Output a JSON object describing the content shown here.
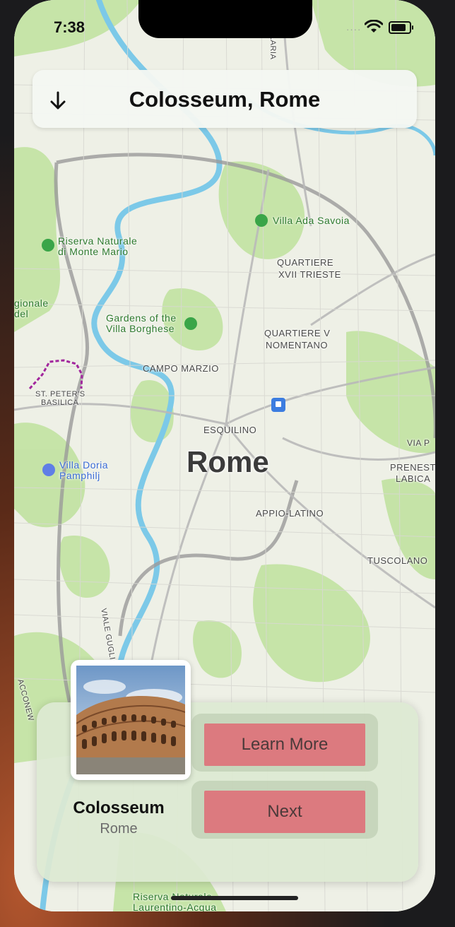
{
  "status_bar": {
    "time": "7:38"
  },
  "header": {
    "title": "Colosseum, Rome",
    "back_icon": "arrow-down-icon"
  },
  "map": {
    "city_label": "Rome",
    "labels": {
      "villa_ada": "Villa Ada Savoia",
      "riserva_1": "Riserva Naturale",
      "riserva_2": "di Monte Mario",
      "quartiere_trieste_1": "QUARTIERE",
      "quartiere_trieste_2": "XVII TRIESTE",
      "regionale_1": "gionale",
      "regionale_2": "del",
      "gardens_1": "Gardens of the",
      "gardens_2": "Villa Borghese",
      "nomentano_1": "QUARTIERE V",
      "nomentano_2": "NOMENTANO",
      "campo_marzio": "CAMPO MARZIO",
      "st_peters_1": "ST. PETER'S",
      "st_peters_2": "BASILICA",
      "esquilino": "ESQUILINO",
      "villa_doria_1": "Villa Doria",
      "villa_doria_2": "Pamphilj",
      "via_p": "VIA P",
      "prenest_1": "PRENEST",
      "prenest_2": "LABICA",
      "appio": "APPIO-LATINO",
      "tuscolano": "TUSCOLANO",
      "viale_gug": "VIALE GUGLIELMO",
      "salaria": "LARIA",
      "riserva_bottom_1": "Riserva Naturale",
      "riserva_bottom_2": "Laurentino-Acqua",
      "circonv": "ACCONEW"
    }
  },
  "place_card": {
    "name": "Colosseum",
    "subtitle": "Rome",
    "learn_more_label": "Learn More",
    "next_label": "Next"
  },
  "colors": {
    "button": "#dc7a7f",
    "park": "#bfe3a0",
    "water": "#7cc9e8",
    "road": "#c9c9c9"
  }
}
